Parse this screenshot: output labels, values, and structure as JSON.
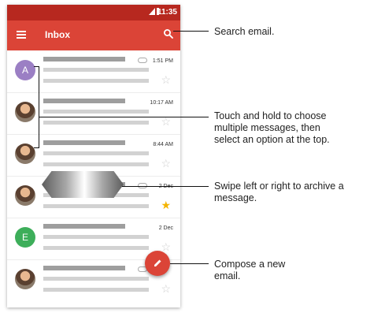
{
  "status_bar": {
    "time": "11:35"
  },
  "app_bar": {
    "title": "Inbox"
  },
  "emails": [
    {
      "avatar_letter": "A",
      "avatar_color": "#9b7fc4",
      "time": "1:51 PM",
      "starred": false,
      "attachment": true
    },
    {
      "avatar_letter": "",
      "avatar_color": "",
      "time": "10:17 AM",
      "starred": false,
      "attachment": false
    },
    {
      "avatar_letter": "",
      "avatar_color": "",
      "time": "8:44 AM",
      "starred": false,
      "attachment": false
    },
    {
      "avatar_letter": "",
      "avatar_color": "",
      "time": "2 Dec",
      "starred": true,
      "attachment": true
    },
    {
      "avatar_letter": "E",
      "avatar_color": "#3dae5a",
      "time": "2 Dec",
      "starred": false,
      "attachment": false
    },
    {
      "avatar_letter": "",
      "avatar_color": "",
      "time": "",
      "starred": false,
      "attachment": true
    }
  ],
  "callouts": {
    "search": "Search email.",
    "select_1": "Touch and hold to choose",
    "select_2": "multiple messages, then",
    "select_3": "select an option at the top.",
    "swipe_1": "Swipe left or right to archive a",
    "swipe_2": "message.",
    "compose_1": "Compose a new",
    "compose_2": "email."
  },
  "colors": {
    "app_bar": "#db4437",
    "status_bar": "#b7281f",
    "star_active": "#f4b400"
  },
  "icons": [
    "menu-icon",
    "search-icon",
    "star-icon",
    "paperclip-icon",
    "pencil-icon"
  ]
}
